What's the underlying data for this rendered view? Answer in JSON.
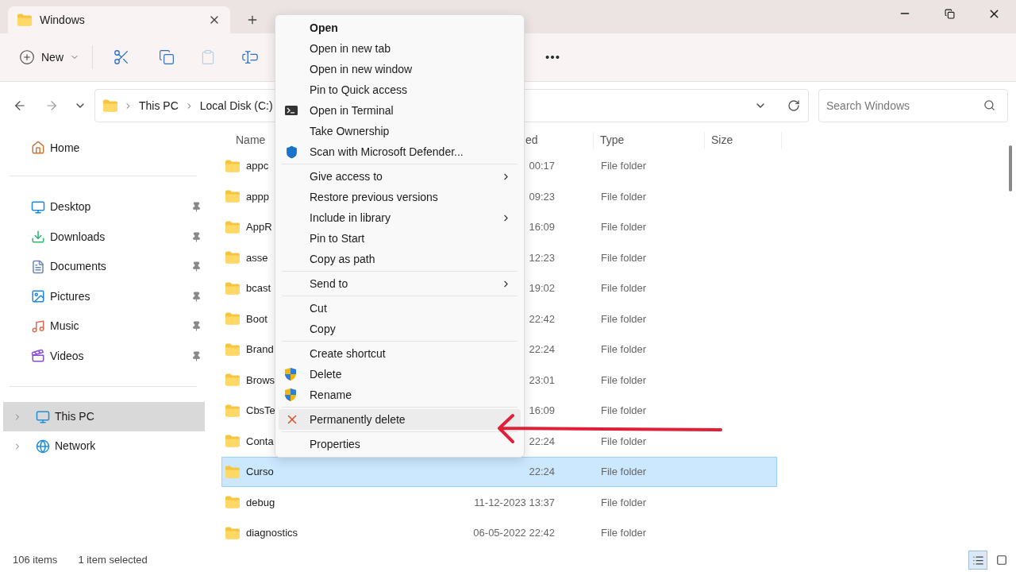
{
  "tab": {
    "title": "Windows",
    "selected": true
  },
  "toolbar": {
    "new_label": "New",
    "paste_disabled": true
  },
  "address": {
    "crumbs": [
      "This PC",
      "Local Disk (C:)"
    ],
    "search_placeholder": "Search Windows"
  },
  "sidebar": {
    "home": "Home",
    "quick": [
      {
        "label": "Desktop",
        "pinned": true
      },
      {
        "label": "Downloads",
        "pinned": true
      },
      {
        "label": "Documents",
        "pinned": true
      },
      {
        "label": "Pictures",
        "pinned": true
      },
      {
        "label": "Music",
        "pinned": true
      },
      {
        "label": "Videos",
        "pinned": true
      }
    ],
    "drives": [
      {
        "label": "This PC",
        "selected": true
      },
      {
        "label": "Network",
        "selected": false
      }
    ]
  },
  "table": {
    "columns": [
      "Name",
      "ed",
      "Type",
      "Size"
    ],
    "rows": [
      {
        "name": "appc",
        "date": "00:17",
        "type": "File folder",
        "selected": false
      },
      {
        "name": "appp",
        "date": "09:23",
        "type": "File folder",
        "selected": false
      },
      {
        "name": "AppR",
        "date": "16:09",
        "type": "File folder",
        "selected": false
      },
      {
        "name": "asse",
        "date": "12:23",
        "type": "File folder",
        "selected": false
      },
      {
        "name": "bcast",
        "date": "19:02",
        "type": "File folder",
        "selected": false
      },
      {
        "name": "Boot",
        "date": "22:42",
        "type": "File folder",
        "selected": false
      },
      {
        "name": "Brand",
        "date": "22:24",
        "type": "File folder",
        "selected": false
      },
      {
        "name": "Brows",
        "date": "23:01",
        "type": "File folder",
        "selected": false
      },
      {
        "name": "CbsTe",
        "date": "16:09",
        "type": "File folder",
        "selected": false
      },
      {
        "name": "Conta",
        "date": "22:24",
        "type": "File folder",
        "selected": false
      },
      {
        "name": "Curso",
        "date": "22:24",
        "type": "File folder",
        "selected": true
      },
      {
        "name": "debug",
        "date": "11-12-2023 13:37",
        "type": "File folder",
        "selected": false
      },
      {
        "name": "diagnostics",
        "date": "06-05-2022 22:42",
        "type": "File folder",
        "selected": false
      }
    ]
  },
  "context_menu": [
    {
      "kind": "plain",
      "label": "Open",
      "submenu": false,
      "hovered": false
    },
    {
      "kind": "plain",
      "label": "Open in new tab",
      "submenu": false,
      "hovered": false
    },
    {
      "kind": "plain",
      "label": "Open in new window",
      "submenu": false,
      "hovered": false
    },
    {
      "kind": "plain",
      "label": "Pin to Quick access",
      "submenu": false,
      "hovered": false
    },
    {
      "kind": "terminal",
      "label": "Open in Terminal",
      "submenu": false,
      "hovered": false
    },
    {
      "kind": "plain",
      "label": "Take Ownership",
      "submenu": false,
      "hovered": false
    },
    {
      "kind": "defender",
      "label": "Scan with Microsoft Defender...",
      "submenu": false,
      "hovered": false
    },
    {
      "kind": "separator"
    },
    {
      "kind": "plain",
      "label": "Give access to",
      "submenu": true,
      "hovered": false
    },
    {
      "kind": "plain",
      "label": "Restore previous versions",
      "submenu": false,
      "hovered": false
    },
    {
      "kind": "plain",
      "label": "Include in library",
      "submenu": true,
      "hovered": false
    },
    {
      "kind": "plain",
      "label": "Pin to Start",
      "submenu": false,
      "hovered": false
    },
    {
      "kind": "plain",
      "label": "Copy as path",
      "submenu": false,
      "hovered": false
    },
    {
      "kind": "separator"
    },
    {
      "kind": "plain",
      "label": "Send to",
      "submenu": true,
      "hovered": false
    },
    {
      "kind": "separator"
    },
    {
      "kind": "plain",
      "label": "Cut",
      "submenu": false,
      "hovered": false
    },
    {
      "kind": "plain",
      "label": "Copy",
      "submenu": false,
      "hovered": false
    },
    {
      "kind": "separator"
    },
    {
      "kind": "plain",
      "label": "Create shortcut",
      "submenu": false,
      "hovered": false
    },
    {
      "kind": "uac",
      "label": "Delete",
      "submenu": false,
      "hovered": false
    },
    {
      "kind": "uac",
      "label": "Rename",
      "submenu": false,
      "hovered": false
    },
    {
      "kind": "separator"
    },
    {
      "kind": "cross",
      "label": "Permanently delete",
      "submenu": false,
      "hovered": true
    },
    {
      "kind": "separator"
    },
    {
      "kind": "plain",
      "label": "Properties",
      "submenu": false,
      "hovered": false
    }
  ],
  "status_bar": {
    "count": "106 items",
    "selection": "1 item selected",
    "views": [
      {
        "selected": true
      },
      {
        "selected": false
      }
    ]
  }
}
